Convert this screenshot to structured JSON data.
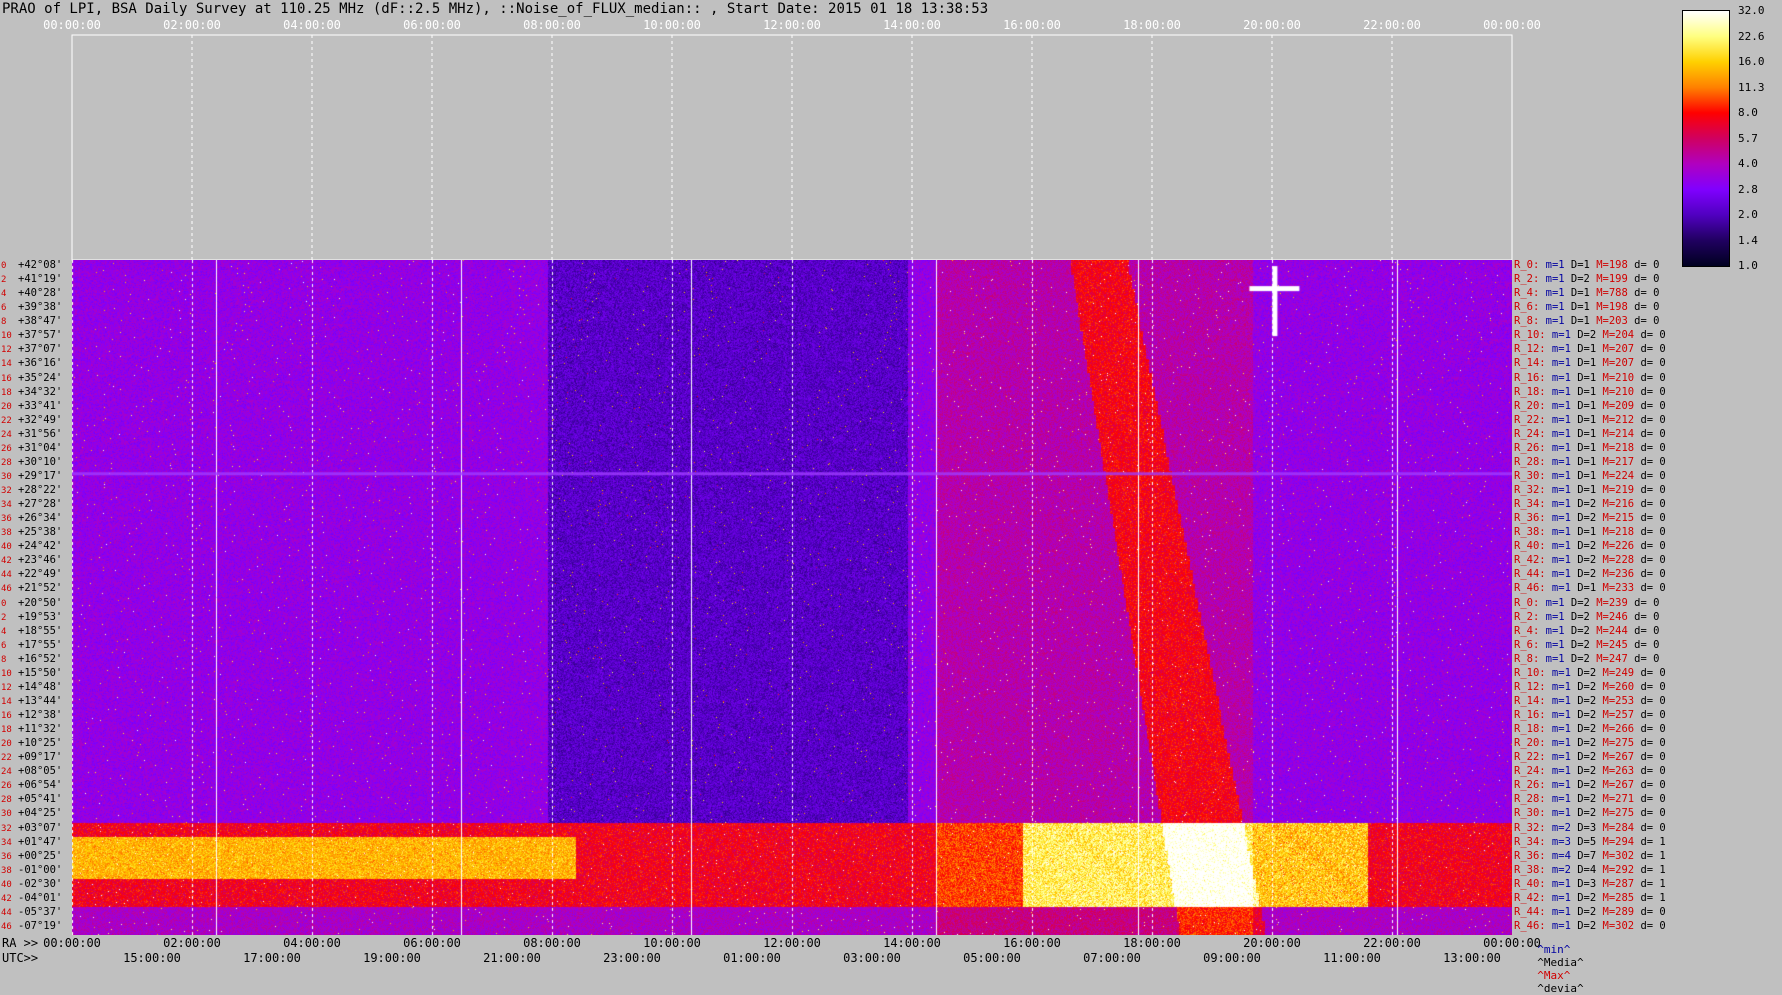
{
  "title": "PRAO of LPI, BSA Daily Survey at 110.25 MHz (dF::2.5 MHz), ::Noise_of_FLUX_median:: , Start Date: 2015 01 18 13:38:53",
  "top_axis_ticks": [
    "00:00:00",
    "02:00:00",
    "04:00:00",
    "06:00:00",
    "08:00:00",
    "10:00:00",
    "12:00:00",
    "14:00:00",
    "16:00:00",
    "18:00:00",
    "20:00:00",
    "22:00:00",
    "00:00:00"
  ],
  "ra_label": "RA >>",
  "ra_ticks": [
    "00:00:00",
    "02:00:00",
    "04:00:00",
    "06:00:00",
    "08:00:00",
    "10:00:00",
    "12:00:00",
    "14:00:00",
    "16:00:00",
    "18:00:00",
    "20:00:00",
    "22:00:00",
    "00:00:00"
  ],
  "utc_label": "UTC>>",
  "utc_ticks": [
    "15:00:00",
    "17:00:00",
    "19:00:00",
    "21:00:00",
    "23:00:00",
    "01:00:00",
    "03:00:00",
    "05:00:00",
    "07:00:00",
    "09:00:00",
    "11:00:00",
    "13:00:00"
  ],
  "colorbar": {
    "ticks": [
      "32.0",
      "22.6",
      "16.0",
      "11.3",
      "8.0",
      "5.7",
      "4.0",
      "2.8",
      "2.0",
      "1.4",
      "1.0"
    ],
    "colors": [
      "#ffffff",
      "#ffff80",
      "#ffd000",
      "#ff8000",
      "#ff0000",
      "#d00060",
      "#b000c0",
      "#8000ff",
      "#5000c0",
      "#200060",
      "#000020"
    ]
  },
  "footer_stats": {
    "min": "^min^",
    "media": "^Media^",
    "max": "^Max^",
    "devia": "^devia^"
  },
  "footer_colors": {
    "min": "#0000a0",
    "media": "#000000",
    "max": "#d00000",
    "devia": "#000000"
  },
  "chart_data": {
    "type": "heatmap",
    "title": "PRAO of LPI, BSA Daily Survey at 110.25 MHz (dF::2.5 MHz), ::Noise_of_FLUX_median:: , Start Date: 2015 01 18 13:38:53",
    "x_axis_ticks": [
      "00:00:00",
      "02:00:00",
      "04:00:00",
      "06:00:00",
      "08:00:00",
      "10:00:00",
      "12:00:00",
      "14:00:00",
      "16:00:00",
      "18:00:00",
      "20:00:00",
      "22:00:00",
      "00:00:00"
    ],
    "y_rows": [
      {
        "idx": "0",
        "dec": "+42°08'",
        "r": "R_0:",
        "m": "m=1",
        "d": "D=1",
        "mx": "M=198",
        "dv": "d= 0"
      },
      {
        "idx": "2",
        "dec": "+41°19'",
        "r": "R_2:",
        "m": "m=1",
        "d": "D=2",
        "mx": "M=199",
        "dv": "d= 0"
      },
      {
        "idx": "4",
        "dec": "+40°28'",
        "r": "R_4:",
        "m": "m=1",
        "d": "D=1",
        "mx": "M=788",
        "dv": "d= 0"
      },
      {
        "idx": "6",
        "dec": "+39°38'",
        "r": "R_6:",
        "m": "m=1",
        "d": "D=1",
        "mx": "M=198",
        "dv": "d= 0"
      },
      {
        "idx": "8",
        "dec": "+38°47'",
        "r": "R_8:",
        "m": "m=1",
        "d": "D=1",
        "mx": "M=203",
        "dv": "d= 0"
      },
      {
        "idx": "10",
        "dec": "+37°57'",
        "r": "R_10:",
        "m": "m=1",
        "d": "D=2",
        "mx": "M=204",
        "dv": "d= 0"
      },
      {
        "idx": "12",
        "dec": "+37°07'",
        "r": "R_12:",
        "m": "m=1",
        "d": "D=1",
        "mx": "M=207",
        "dv": "d= 0"
      },
      {
        "idx": "14",
        "dec": "+36°16'",
        "r": "R_14:",
        "m": "m=1",
        "d": "D=1",
        "mx": "M=207",
        "dv": "d= 0"
      },
      {
        "idx": "16",
        "dec": "+35°24'",
        "r": "R_16:",
        "m": "m=1",
        "d": "D=1",
        "mx": "M=210",
        "dv": "d= 0"
      },
      {
        "idx": "18",
        "dec": "+34°32'",
        "r": "R_18:",
        "m": "m=1",
        "d": "D=1",
        "mx": "M=210",
        "dv": "d= 0"
      },
      {
        "idx": "20",
        "dec": "+33°41'",
        "r": "R_20:",
        "m": "m=1",
        "d": "D=1",
        "mx": "M=209",
        "dv": "d= 0"
      },
      {
        "idx": "22",
        "dec": "+32°49'",
        "r": "R_22:",
        "m": "m=1",
        "d": "D=1",
        "mx": "M=212",
        "dv": "d= 0"
      },
      {
        "idx": "24",
        "dec": "+31°56'",
        "r": "R_24:",
        "m": "m=1",
        "d": "D=1",
        "mx": "M=214",
        "dv": "d= 0"
      },
      {
        "idx": "26",
        "dec": "+31°04'",
        "r": "R_26:",
        "m": "m=1",
        "d": "D=1",
        "mx": "M=218",
        "dv": "d= 0"
      },
      {
        "idx": "28",
        "dec": "+30°10'",
        "r": "R_28:",
        "m": "m=1",
        "d": "D=1",
        "mx": "M=217",
        "dv": "d= 0"
      },
      {
        "idx": "30",
        "dec": "+29°17'",
        "r": "R_30:",
        "m": "m=1",
        "d": "D=1",
        "mx": "M=224",
        "dv": "d= 0"
      },
      {
        "idx": "32",
        "dec": "+28°22'",
        "r": "R_32:",
        "m": "m=1",
        "d": "D=1",
        "mx": "M=219",
        "dv": "d= 0"
      },
      {
        "idx": "34",
        "dec": "+27°28'",
        "r": "R_34:",
        "m": "m=1",
        "d": "D=2",
        "mx": "M=216",
        "dv": "d= 0"
      },
      {
        "idx": "36",
        "dec": "+26°34'",
        "r": "R_36:",
        "m": "m=1",
        "d": "D=2",
        "mx": "M=215",
        "dv": "d= 0"
      },
      {
        "idx": "38",
        "dec": "+25°38'",
        "r": "R_38:",
        "m": "m=1",
        "d": "D=1",
        "mx": "M=218",
        "dv": "d= 0"
      },
      {
        "idx": "40",
        "dec": "+24°42'",
        "r": "R_40:",
        "m": "m=1",
        "d": "D=2",
        "mx": "M=226",
        "dv": "d= 0"
      },
      {
        "idx": "42",
        "dec": "+23°46'",
        "r": "R_42:",
        "m": "m=1",
        "d": "D=2",
        "mx": "M=228",
        "dv": "d= 0"
      },
      {
        "idx": "44",
        "dec": "+22°49'",
        "r": "R_44:",
        "m": "m=1",
        "d": "D=2",
        "mx": "M=236",
        "dv": "d= 0"
      },
      {
        "idx": "46",
        "dec": "+21°52'",
        "r": "R_46:",
        "m": "m=1",
        "d": "D=1",
        "mx": "M=233",
        "dv": "d= 0"
      },
      {
        "idx": "0",
        "dec": "+20°50'",
        "r": "R_0:",
        "m": "m=1",
        "d": "D=2",
        "mx": "M=239",
        "dv": "d= 0"
      },
      {
        "idx": "2",
        "dec": "+19°53'",
        "r": "R_2:",
        "m": "m=1",
        "d": "D=2",
        "mx": "M=246",
        "dv": "d= 0"
      },
      {
        "idx": "4",
        "dec": "+18°55'",
        "r": "R_4:",
        "m": "m=1",
        "d": "D=2",
        "mx": "M=244",
        "dv": "d= 0"
      },
      {
        "idx": "6",
        "dec": "+17°55'",
        "r": "R_6:",
        "m": "m=1",
        "d": "D=2",
        "mx": "M=245",
        "dv": "d= 0"
      },
      {
        "idx": "8",
        "dec": "+16°52'",
        "r": "R_8:",
        "m": "m=1",
        "d": "D=2",
        "mx": "M=247",
        "dv": "d= 0"
      },
      {
        "idx": "10",
        "dec": "+15°50'",
        "r": "R_10:",
        "m": "m=1",
        "d": "D=2",
        "mx": "M=249",
        "dv": "d= 0"
      },
      {
        "idx": "12",
        "dec": "+14°48'",
        "r": "R_12:",
        "m": "m=1",
        "d": "D=2",
        "mx": "M=260",
        "dv": "d= 0"
      },
      {
        "idx": "14",
        "dec": "+13°44'",
        "r": "R_14:",
        "m": "m=1",
        "d": "D=2",
        "mx": "M=253",
        "dv": "d= 0"
      },
      {
        "idx": "16",
        "dec": "+12°38'",
        "r": "R_16:",
        "m": "m=1",
        "d": "D=2",
        "mx": "M=257",
        "dv": "d= 0"
      },
      {
        "idx": "18",
        "dec": "+11°32'",
        "r": "R_18:",
        "m": "m=1",
        "d": "D=2",
        "mx": "M=266",
        "dv": "d= 0"
      },
      {
        "idx": "20",
        "dec": "+10°25'",
        "r": "R_20:",
        "m": "m=1",
        "d": "D=2",
        "mx": "M=275",
        "dv": "d= 0"
      },
      {
        "idx": "22",
        "dec": "+09°17'",
        "r": "R_22:",
        "m": "m=1",
        "d": "D=2",
        "mx": "M=267",
        "dv": "d= 0"
      },
      {
        "idx": "24",
        "dec": "+08°05'",
        "r": "R_24:",
        "m": "m=1",
        "d": "D=2",
        "mx": "M=263",
        "dv": "d= 0"
      },
      {
        "idx": "26",
        "dec": "+06°54'",
        "r": "R_26:",
        "m": "m=1",
        "d": "D=2",
        "mx": "M=267",
        "dv": "d= 0"
      },
      {
        "idx": "28",
        "dec": "+05°41'",
        "r": "R_28:",
        "m": "m=1",
        "d": "D=2",
        "mx": "M=271",
        "dv": "d= 0"
      },
      {
        "idx": "30",
        "dec": "+04°25'",
        "r": "R_30:",
        "m": "m=1",
        "d": "D=2",
        "mx": "M=275",
        "dv": "d= 0"
      },
      {
        "idx": "32",
        "dec": "+03°07'",
        "r": "R_32:",
        "m": "m=2",
        "d": "D=3",
        "mx": "M=284",
        "dv": "d= 0"
      },
      {
        "idx": "34",
        "dec": "+01°47'",
        "r": "R_34:",
        "m": "m=3",
        "d": "D=5",
        "mx": "M=294",
        "dv": "d= 1"
      },
      {
        "idx": "36",
        "dec": "+00°25'",
        "r": "R_36:",
        "m": "m=4",
        "d": "D=7",
        "mx": "M=302",
        "dv": "d= 1"
      },
      {
        "idx": "38",
        "dec": "-01°00'",
        "r": "R_38:",
        "m": "m=2",
        "d": "D=4",
        "mx": "M=292",
        "dv": "d= 1"
      },
      {
        "idx": "40",
        "dec": "-02°30'",
        "r": "R_40:",
        "m": "m=1",
        "d": "D=3",
        "mx": "M=287",
        "dv": "d= 1"
      },
      {
        "idx": "42",
        "dec": "-04°01'",
        "r": "R_42:",
        "m": "m=1",
        "d": "D=2",
        "mx": "M=285",
        "dv": "d= 1"
      },
      {
        "idx": "44",
        "dec": "-05°37'",
        "r": "R_44:",
        "m": "m=1",
        "d": "D=2",
        "mx": "M=289",
        "dv": "d= 0"
      },
      {
        "idx": "46",
        "dec": "-07°19'",
        "r": "R_46:",
        "m": "m=1",
        "d": "D=2",
        "mx": "M=302",
        "dv": "d= 0"
      }
    ],
    "colorbar_range": [
      1.0,
      32.0
    ]
  }
}
